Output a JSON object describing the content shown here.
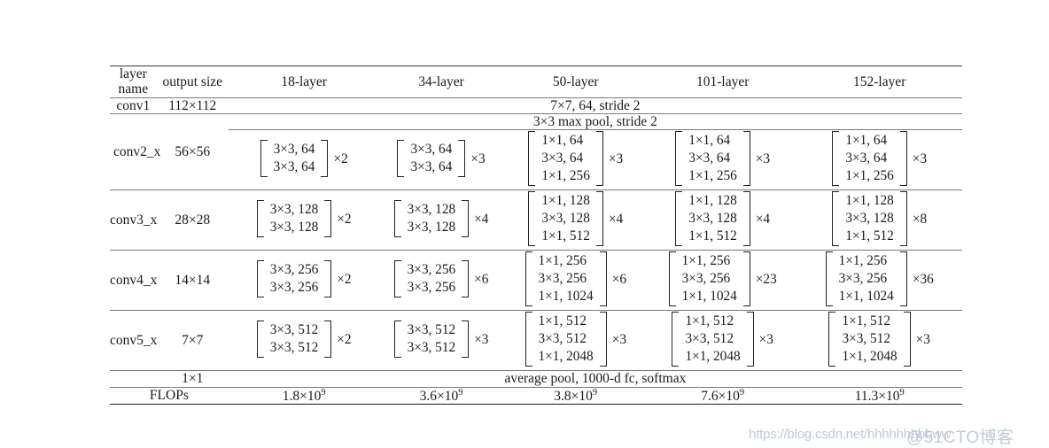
{
  "table": {
    "columns": [
      "layer name",
      "output size",
      "18-layer",
      "34-layer",
      "50-layer",
      "101-layer",
      "152-layer"
    ],
    "conv1": {
      "layer_name": "conv1",
      "output_size": "112×112",
      "spec": "7×7, 64, stride 2"
    },
    "maxpool": {
      "spec": "3×3 max pool, stride 2"
    },
    "conv2_x": {
      "layer_name": "conv2_x",
      "output_size": "56×56",
      "l18": {
        "rows": [
          "3×3, 64",
          "3×3, 64"
        ],
        "mult": "×2"
      },
      "l34": {
        "rows": [
          "3×3, 64",
          "3×3, 64"
        ],
        "mult": "×3"
      },
      "l50": {
        "rows": [
          "1×1, 64",
          "3×3, 64",
          "1×1, 256"
        ],
        "mult": "×3"
      },
      "l101": {
        "rows": [
          "1×1, 64",
          "3×3, 64",
          "1×1, 256"
        ],
        "mult": "×3"
      },
      "l152": {
        "rows": [
          "1×1, 64",
          "3×3, 64",
          "1×1, 256"
        ],
        "mult": "×3"
      }
    },
    "conv3_x": {
      "layer_name": "conv3_x",
      "output_size": "28×28",
      "l18": {
        "rows": [
          "3×3, 128",
          "3×3, 128"
        ],
        "mult": "×2"
      },
      "l34": {
        "rows": [
          "3×3, 128",
          "3×3, 128"
        ],
        "mult": "×4"
      },
      "l50": {
        "rows": [
          "1×1, 128",
          "3×3, 128",
          "1×1, 512"
        ],
        "mult": "×4"
      },
      "l101": {
        "rows": [
          "1×1, 128",
          "3×3, 128",
          "1×1, 512"
        ],
        "mult": "×4"
      },
      "l152": {
        "rows": [
          "1×1, 128",
          "3×3, 128",
          "1×1, 512"
        ],
        "mult": "×8"
      }
    },
    "conv4_x": {
      "layer_name": "conv4_x",
      "output_size": "14×14",
      "l18": {
        "rows": [
          "3×3, 256",
          "3×3, 256"
        ],
        "mult": "×2"
      },
      "l34": {
        "rows": [
          "3×3, 256",
          "3×3, 256"
        ],
        "mult": "×6"
      },
      "l50": {
        "rows": [
          "1×1, 256",
          "3×3, 256",
          "1×1, 1024"
        ],
        "mult": "×6"
      },
      "l101": {
        "rows": [
          "1×1, 256",
          "3×3, 256",
          "1×1, 1024"
        ],
        "mult": "×23"
      },
      "l152": {
        "rows": [
          "1×1, 256",
          "3×3, 256",
          "1×1, 1024"
        ],
        "mult": "×36"
      }
    },
    "conv5_x": {
      "layer_name": "conv5_x",
      "output_size": "7×7",
      "l18": {
        "rows": [
          "3×3, 512",
          "3×3, 512"
        ],
        "mult": "×2"
      },
      "l34": {
        "rows": [
          "3×3, 512",
          "3×3, 512"
        ],
        "mult": "×3"
      },
      "l50": {
        "rows": [
          "1×1, 512",
          "3×3, 512",
          "1×1, 2048"
        ],
        "mult": "×3"
      },
      "l101": {
        "rows": [
          "1×1, 512",
          "3×3, 512",
          "1×1, 2048"
        ],
        "mult": "×3"
      },
      "l152": {
        "rows": [
          "1×1, 512",
          "3×3, 512",
          "1×1, 2048"
        ],
        "mult": "×3"
      }
    },
    "pool_fc": {
      "layer_name": "",
      "output_size": "1×1",
      "spec": "average pool, 1000-d fc, softmax"
    },
    "flops": {
      "label": "FLOPs",
      "l18": {
        "mantissa": "1.8×10",
        "exp": "9"
      },
      "l34": {
        "mantissa": "3.6×10",
        "exp": "9"
      },
      "l50": {
        "mantissa": "3.8×10",
        "exp": "9"
      },
      "l101": {
        "mantissa": "7.6×10",
        "exp": "9"
      },
      "l152": {
        "mantissa": "11.3×10",
        "exp": "9"
      }
    }
  },
  "watermark": {
    "url": "https://blog.csdn.net/hhhhhhbbbww",
    "brand": "@51CTO博客"
  }
}
